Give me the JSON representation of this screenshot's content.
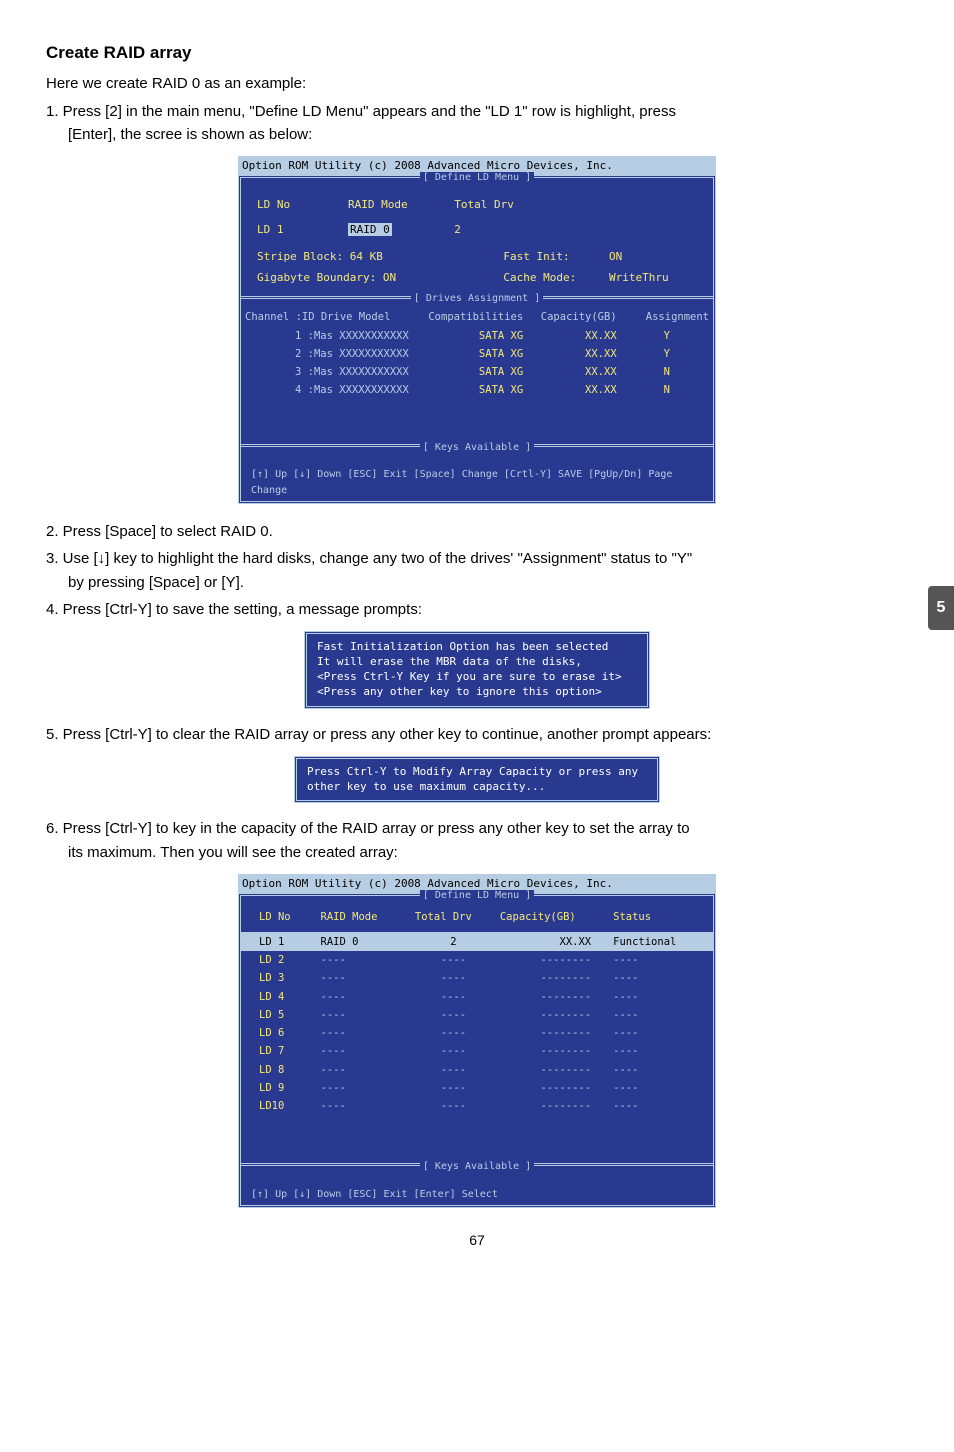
{
  "heading": "Create RAID array",
  "intro": "Here we create RAID 0 as an example:",
  "step1_a": "1. Press [2] in the main menu, \"Define LD Menu\" appears and the \"LD 1\" row is highlight, press",
  "step1_b": "[Enter], the scree is shown as below:",
  "bios1": {
    "title": "Option ROM Utility (c) 2008 Advanced Micro Devices, Inc.",
    "top_label": "[ Define LD Menu ]",
    "hdr_ldno": "LD No",
    "hdr_mode": "RAID Mode",
    "hdr_drv": "Total Drv",
    "ld_row_no": "LD   1",
    "ld_row_mode": "RAID 0",
    "ld_row_drv": "2",
    "stripe_l": "Stripe Block:          64   KB",
    "gig_l": "Gigabyte Boundary: ON",
    "fast_k": "Fast Init:",
    "fast_v": "ON",
    "cache_k": "Cache Mode:",
    "cache_v": "WriteThru",
    "da_label": "[ Drives Assignment ]",
    "th_ch": "Channel :ID   Drive Model",
    "th_comp": "Compatibilities",
    "th_cap": "Capacity(GB)",
    "th_asg": "Assignment",
    "drives": [
      {
        "ch": "1 :Mas  XXXXXXXXXXX",
        "comp": "SATA  XG",
        "cap": "XX.XX",
        "asg": "Y"
      },
      {
        "ch": "2 :Mas  XXXXXXXXXXX",
        "comp": "SATA  XG",
        "cap": "XX.XX",
        "asg": "Y"
      },
      {
        "ch": "3 :Mas  XXXXXXXXXXX",
        "comp": "SATA  XG",
        "cap": "XX.XX",
        "asg": "N"
      },
      {
        "ch": "4 :Mas  XXXXXXXXXXX",
        "comp": "SATA  XG",
        "cap": "XX.XX",
        "asg": "N"
      }
    ],
    "ka_label": "[ Keys Available ]",
    "keys": "[↑] Up  [↓] Down  [ESC] Exit  [Space] Change  [Crtl-Y] SAVE   [PgUp/Dn] Page Change"
  },
  "step2": "2. Press [Space] to select RAID 0.",
  "step3_a": "3. Use [↓] key to highlight the hard disks, change any two of the drives' \"Assignment\" status to \"Y\"",
  "step3_b": "by pressing [Space] or [Y].",
  "step4": "4. Press [Ctrl-Y] to save the setting, a message prompts:",
  "dlg1_l1": "Fast Initialization Option has been selected",
  "dlg1_l2": "It will erase the MBR data of the disks,",
  "dlg1_l3": "<Press Ctrl-Y Key if you are sure to erase it>",
  "dlg1_l4": "<Press any other key to ignore this option>",
  "step5": "5. Press [Ctrl-Y] to clear the RAID array or press any other key to continue, another prompt appears:",
  "dlg2_l1": "Press Ctrl-Y to Modify Array Capacity or press any",
  "dlg2_l2": "other key to use maximum capacity...",
  "step6_a": "6. Press [Ctrl-Y] to key in the capacity of the RAID array or press any other key to set the array to",
  "step6_b": "its maximum. Then you will see the created array:",
  "bios2": {
    "title": "Option ROM Utility (c) 2008 Advanced Micro Devices, Inc.",
    "top_label": "[ Define LD Menu ]",
    "th_ldno": "LD No",
    "th_mode": "RAID Mode",
    "th_drv": "Total Drv",
    "th_cap": "Capacity(GB)",
    "th_stat": "Status",
    "rows": [
      {
        "no": "LD   1",
        "mode": "RAID 0",
        "drv": "2",
        "cap": "XX.XX",
        "stat": "Functional",
        "sel": true
      },
      {
        "no": "LD   2",
        "mode": "----",
        "drv": "----",
        "cap": "--------",
        "stat": "----"
      },
      {
        "no": "LD   3",
        "mode": "----",
        "drv": "----",
        "cap": "--------",
        "stat": "----"
      },
      {
        "no": "LD   4",
        "mode": "----",
        "drv": "----",
        "cap": "--------",
        "stat": "----"
      },
      {
        "no": "LD   5",
        "mode": "----",
        "drv": "----",
        "cap": "--------",
        "stat": "----"
      },
      {
        "no": "LD   6",
        "mode": "----",
        "drv": "----",
        "cap": "--------",
        "stat": "----"
      },
      {
        "no": "LD   7",
        "mode": "----",
        "drv": "----",
        "cap": "--------",
        "stat": "----"
      },
      {
        "no": "LD   8",
        "mode": "----",
        "drv": "----",
        "cap": "--------",
        "stat": "----"
      },
      {
        "no": "LD   9",
        "mode": "----",
        "drv": "----",
        "cap": "--------",
        "stat": "----"
      },
      {
        "no": "LD10",
        "mode": "----",
        "drv": "----",
        "cap": "--------",
        "stat": "----"
      }
    ],
    "ka_label": "[ Keys Available ]",
    "keys": "[↑] Up     [↓] Down     [ESC] Exit     [Enter] Select"
  },
  "side_tab": "5",
  "page_num": "67"
}
